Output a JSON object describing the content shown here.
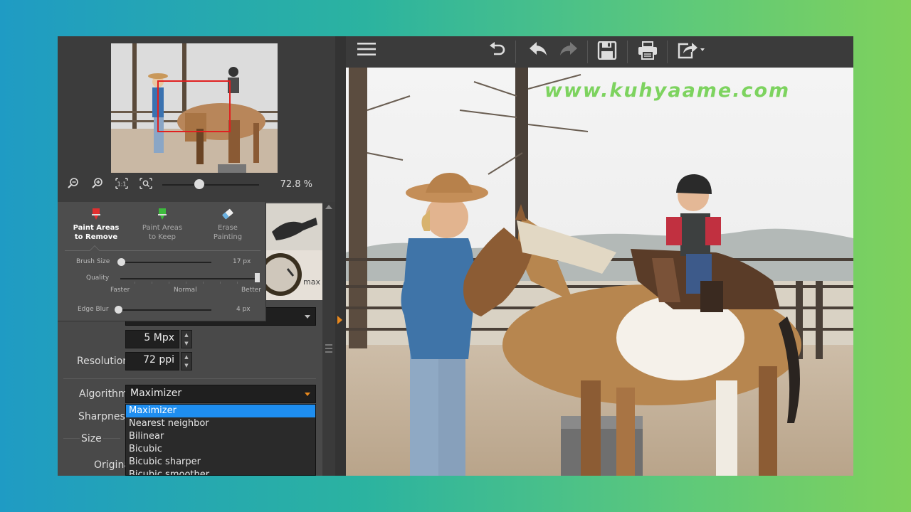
{
  "navigator": {
    "zoom_value": "72.8 %",
    "zoom_slider_fraction": 0.38
  },
  "brush_panel": {
    "tools": [
      {
        "label": "Paint Areas to Remove",
        "line1": "Paint Areas",
        "line2": "to Remove",
        "icon": "red-marker-icon",
        "color": "#e03030"
      },
      {
        "label": "Paint Areas to Keep",
        "line1": "Paint Areas",
        "line2": "to Keep",
        "icon": "green-marker-icon",
        "color": "#3dbb3d"
      },
      {
        "label": "Erase Painting",
        "line1": "Erase",
        "line2": "Painting",
        "icon": "eraser-icon",
        "color": "#6ab0e0"
      }
    ],
    "brush_size_label": "Brush Size",
    "brush_size_value": "17 px",
    "quality_label": "Quality",
    "quality_faster": "Faster",
    "quality_normal": "Normal",
    "quality_better": "Better",
    "edge_blur_label": "Edge Blur",
    "edge_blur_value": "4 px"
  },
  "photo_strip_text": "max",
  "settings": {
    "size_value": "5 Mpx",
    "resolution_label": "Resolution",
    "resolution_value": "72 ppi",
    "algorithm_label": "Algorithm",
    "algorithm_value": "Maximizer",
    "sharpness_label": "Sharpness",
    "size_section_label": "Size",
    "original_label": "Origina",
    "algorithm_options": [
      "Maximizer",
      "Nearest neighbor",
      "Bilinear",
      "Bicubic",
      "Bicubic sharper",
      "Bicubic smoother"
    ]
  },
  "toolbar": {
    "menu_icon": "hamburger-icon",
    "revert_icon": "revert-icon",
    "undo_icon": "undo-icon",
    "redo_icon": "redo-icon",
    "save_icon": "save-icon",
    "print_icon": "print-icon",
    "export_icon": "export-icon"
  },
  "watermark": "www.kuhyaame.com",
  "colors": {
    "accent": "#e8881d",
    "selection": "#1e8ef0",
    "nav_rect": "#e02020"
  }
}
